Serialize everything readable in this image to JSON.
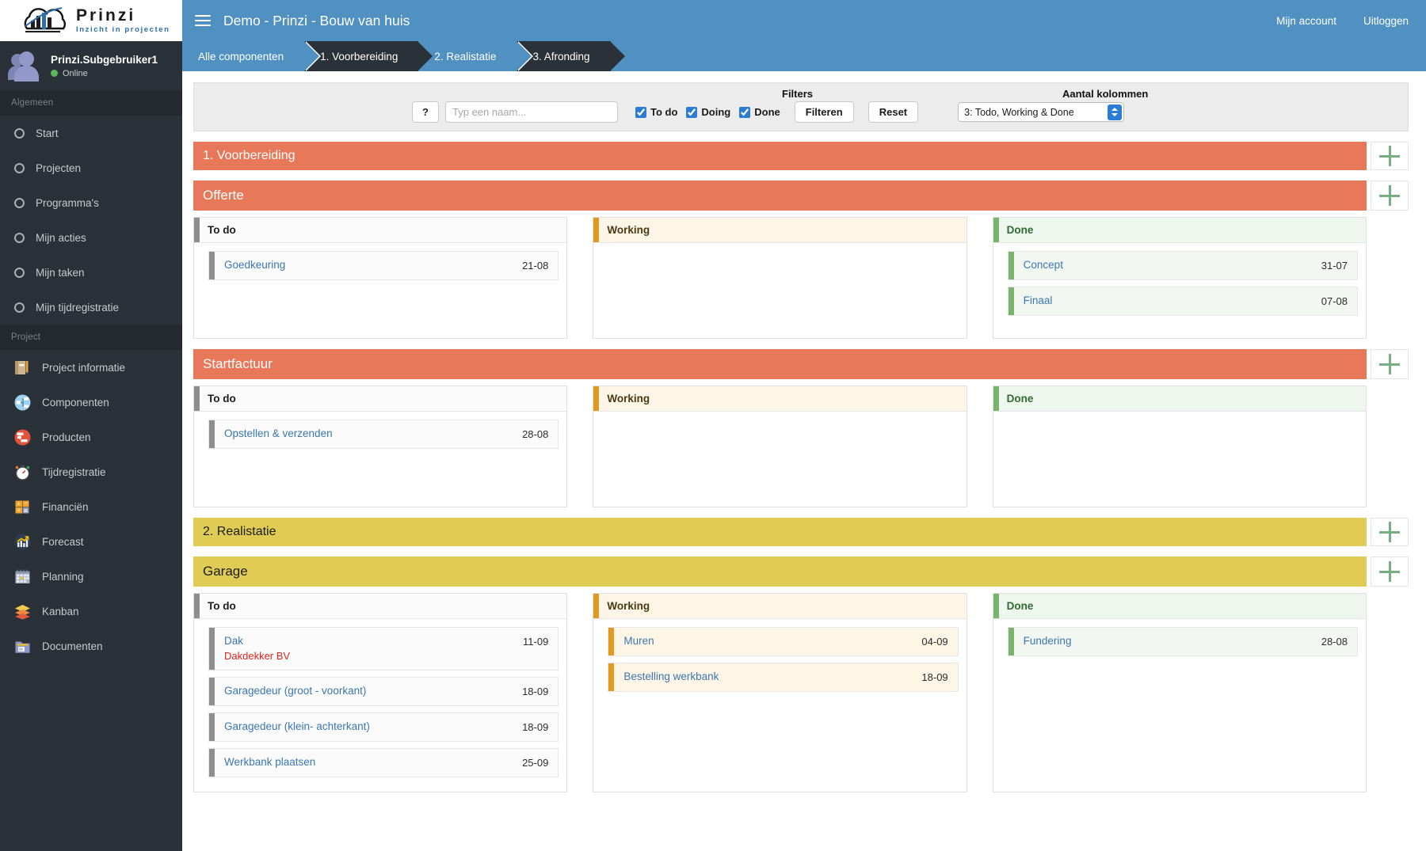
{
  "brand": {
    "name": "Prinzi",
    "tagline": "Inzicht in projecten"
  },
  "user": {
    "name": "Prinzi.Subgebruiker1",
    "status": "Online"
  },
  "sidebar": {
    "section_general": "Algemeen",
    "general_items": [
      {
        "label": "Start",
        "icon": "circle-icon"
      },
      {
        "label": "Projecten",
        "icon": "circle-icon"
      },
      {
        "label": "Programma's",
        "icon": "circle-icon"
      },
      {
        "label": "Mijn acties",
        "icon": "circle-icon"
      },
      {
        "label": "Mijn taken",
        "icon": "circle-icon"
      },
      {
        "label": "Mijn tijdregistratie",
        "icon": "circle-icon"
      }
    ],
    "section_project": "Project",
    "project_items": [
      {
        "label": "Project informatie",
        "icon": "notebook-icon"
      },
      {
        "label": "Componenten",
        "icon": "components-icon"
      },
      {
        "label": "Producten",
        "icon": "products-icon"
      },
      {
        "label": "Tijdregistratie",
        "icon": "stopwatch-icon"
      },
      {
        "label": "Financiën",
        "icon": "calculator-icon"
      },
      {
        "label": "Forecast",
        "icon": "chart-icon"
      },
      {
        "label": "Planning",
        "icon": "calendar-icon"
      },
      {
        "label": "Kanban",
        "icon": "layers-icon"
      },
      {
        "label": "Documenten",
        "icon": "folder-icon"
      }
    ]
  },
  "topbar": {
    "menu_icon": "hamburger-icon",
    "title": "Demo - Prinzi - Bouw van huis",
    "account_link": "Mijn account",
    "logout_link": "Uitloggen"
  },
  "breadcrumb": [
    {
      "label": "Alle componenten",
      "style": "light"
    },
    {
      "label": "1. Voorbereiding",
      "style": "dark"
    },
    {
      "label": "2. Realistatie",
      "style": "light"
    },
    {
      "label": "3. Afronding",
      "style": "dark"
    }
  ],
  "filterbar": {
    "help_label": "?",
    "name_placeholder": "Typ een naam...",
    "name_value": "",
    "filters_label": "Filters",
    "checkboxes": [
      {
        "label": "To do",
        "checked": true
      },
      {
        "label": "Doing",
        "checked": true
      },
      {
        "label": "Done",
        "checked": true
      }
    ],
    "filter_button": "Filteren",
    "reset_button": "Reset",
    "columns_label": "Aantal kolommen",
    "columns_value": "3: Todo, Working & Done"
  },
  "column_titles": {
    "todo": "To do",
    "working": "Working",
    "done": "Done"
  },
  "phases": [
    {
      "title": "1. Voorbereiding",
      "color": "orange",
      "components": [
        {
          "title": "Offerte",
          "color": "orange",
          "todo": [
            {
              "title": "Goedkeuring",
              "sub": "",
              "date": "21-08"
            }
          ],
          "working": [],
          "done": [
            {
              "title": "Concept",
              "sub": "",
              "date": "31-07"
            },
            {
              "title": "Finaal",
              "sub": "",
              "date": "07-08"
            }
          ]
        },
        {
          "title": "Startfactuur",
          "color": "orange",
          "todo": [
            {
              "title": "Opstellen & verzenden",
              "sub": "",
              "date": "28-08"
            }
          ],
          "working": [],
          "done": []
        }
      ]
    },
    {
      "title": "2. Realistatie",
      "color": "yellow",
      "components": [
        {
          "title": "Garage",
          "color": "yellow",
          "todo": [
            {
              "title": "Dak",
              "sub": "Dakdekker BV",
              "date": "11-09"
            },
            {
              "title": "Garagedeur (groot - voorkant)",
              "sub": "",
              "date": "18-09"
            },
            {
              "title": "Garagedeur (klein- achterkant)",
              "sub": "",
              "date": "18-09"
            },
            {
              "title": "Werkbank plaatsen",
              "sub": "",
              "date": "25-09"
            }
          ],
          "working": [
            {
              "title": "Muren",
              "sub": "",
              "date": "04-09"
            },
            {
              "title": "Bestelling werkbank",
              "sub": "",
              "date": "18-09"
            }
          ],
          "done": [
            {
              "title": "Fundering",
              "sub": "",
              "date": "28-08"
            }
          ]
        }
      ]
    }
  ],
  "colors": {
    "accent_blue": "#5191c1",
    "sidebar_dark": "#2b3138",
    "phase_orange": "#e8785a",
    "phase_yellow": "#e0cb55",
    "link_blue": "#3a77b0",
    "alert_red": "#e0241c",
    "done_green": "#79b36c",
    "working_orange": "#e09a22",
    "plus_green": "#76b082"
  }
}
